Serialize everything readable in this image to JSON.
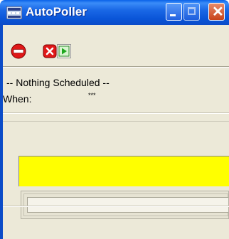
{
  "window": {
    "title": "AutoPoller",
    "app_icon": "autopoller-app-icon",
    "title_buttons": [
      "minimize",
      "maximize",
      "close"
    ]
  },
  "toolbar": {
    "buttons": [
      {
        "name": "stop",
        "icon": "stop-sign-icon"
      },
      {
        "name": "cancel",
        "icon": "red-x-icon"
      },
      {
        "name": "start",
        "icon": "green-play-icon"
      }
    ]
  },
  "schedule": {
    "status": "-- Nothing Scheduled --",
    "when_label": "When:",
    "when_value": "***"
  },
  "progress": {
    "status_bar_color": "#ffff00"
  },
  "colors": {
    "titlebar": "#0a55d8",
    "client": "#ece9d8",
    "close_button": "#c8441c"
  }
}
